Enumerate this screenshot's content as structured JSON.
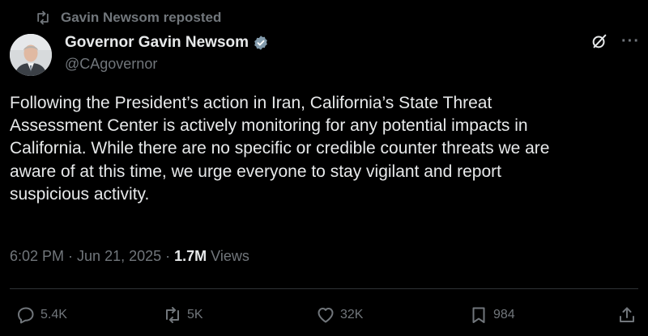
{
  "repost_banner": {
    "text": "Gavin Newsom reposted"
  },
  "author": {
    "display_name": "Governor Gavin Newsom",
    "handle": "@CAgovernor",
    "verified_badge": "verified-badge-icon",
    "badge_color": "#829aab"
  },
  "tweet": {
    "text": "Following the President’s action in Iran, California’s State Threat\nAssessment Center is actively monitoring for any potential impacts in\nCalifornia. While there are no specific or credible counter threats we are\naware of at this time, we urge everyone to stay vigilant and report\nsuspicious activity."
  },
  "meta": {
    "time": "6:02 PM",
    "separator": "·",
    "date": "Jun 21, 2025",
    "views_count": "1.7M",
    "views_label": "Views"
  },
  "actions": {
    "replies": "5.4K",
    "reposts": "5K",
    "likes": "32K",
    "bookmarks": "984"
  },
  "more_menu": {
    "icon": "···"
  },
  "colors": {
    "background": "#000000",
    "text_primary": "#e7e9ea",
    "text_secondary": "#71767b",
    "divider": "#2f3336"
  }
}
